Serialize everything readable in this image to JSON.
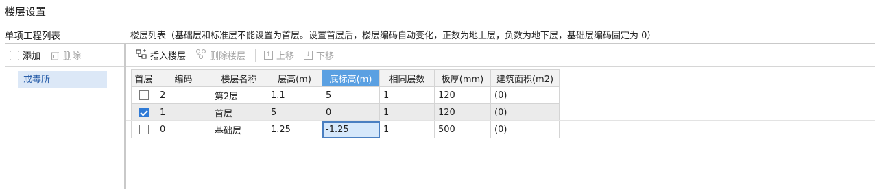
{
  "window": {
    "title": "楼层设置"
  },
  "left": {
    "header": "单项工程列表",
    "add_label": "添加",
    "delete_label": "删除",
    "items": [
      {
        "label": "戒毒所"
      }
    ]
  },
  "right": {
    "header": "楼层列表（基础层和标准层不能设置为首层。设置首层后，楼层编码自动变化，正数为地上层，负数为地下层，基础层编码固定为 0）",
    "toolbar": {
      "insert_label": "插入楼层",
      "delete_label": "删除楼层",
      "up_label": "上移",
      "down_label": "下移"
    },
    "columns": [
      "首层",
      "编码",
      "楼层名称",
      "层高(m)",
      "底标高(m)",
      "相同层数",
      "板厚(mm)",
      "建筑面积(m2)"
    ],
    "rows": [
      {
        "first": false,
        "code": "2",
        "name": "第2层",
        "height": "1.1",
        "base": "5",
        "same": "1",
        "thick": "120",
        "area": "(0)"
      },
      {
        "first": true,
        "code": "1",
        "name": "首层",
        "height": "5",
        "base": "0",
        "same": "1",
        "thick": "120",
        "area": "(0)"
      },
      {
        "first": false,
        "code": "0",
        "name": "基础层",
        "height": "1.25",
        "base": "-1.25",
        "same": "1",
        "thick": "500",
        "area": "(0)"
      }
    ]
  },
  "colors": {
    "accent": "#5aa0e2",
    "selected_item": "#dce8f7",
    "checked": "#2f7ad6"
  }
}
